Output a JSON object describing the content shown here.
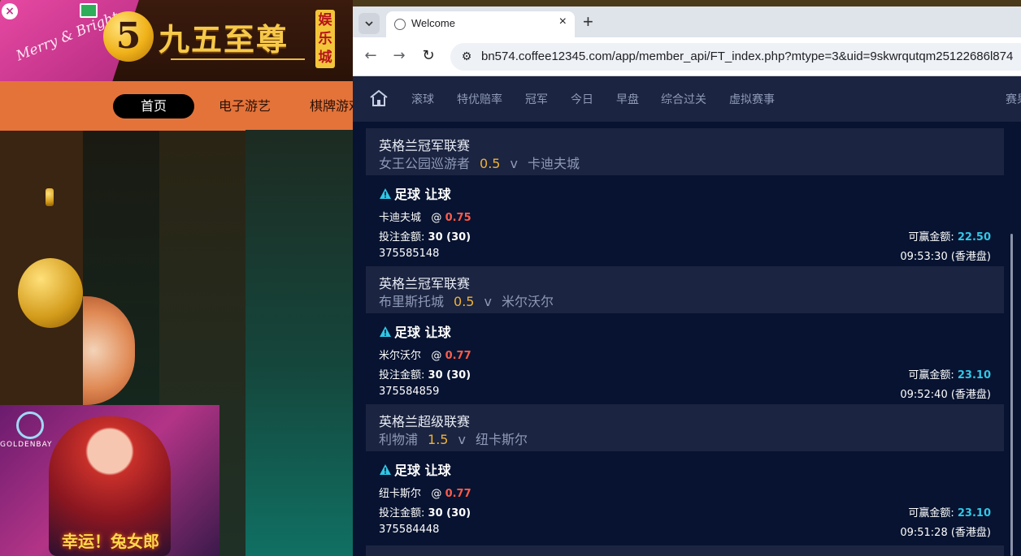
{
  "bg_site": {
    "corner_text": "Merry & Bright",
    "close_glyph": "×",
    "logo_numeral": "5",
    "logo_text": "九五至尊",
    "logo_side": "娱乐城",
    "nav": [
      "首页",
      "电子游艺",
      "棋牌游戏"
    ],
    "promo_brand": "GOLDENBAY",
    "promo_title": "幸运！兔女郎"
  },
  "browser": {
    "tab_dropdown_icon": "chevron-down-icon",
    "tab_title": "Welcome",
    "tab_close": "×",
    "new_tab": "+",
    "back": "←",
    "forward": "→",
    "reload": "↻",
    "site_info": "⚙",
    "url": "bn574.coffee12345.com/app/member_api/FT_index.php?mtype=3&uid=9skwrqutqm25122686l874"
  },
  "page": {
    "nav": [
      "滚球",
      "特优赔率",
      "冠军",
      "今日",
      "早盘",
      "综合过关",
      "虚拟赛事",
      "赛果"
    ],
    "labels": {
      "bet_type": "足球 让球",
      "stake": "投注金额:",
      "win": "可赢金额:",
      "at": "@"
    },
    "bets": [
      {
        "league": "英格兰冠军联赛",
        "home": "女王公园巡游者",
        "handicap": "0.5",
        "vs": "v",
        "away": "卡迪夫城",
        "pick": "卡迪夫城",
        "odds": "0.75",
        "stake": "30 (30)",
        "win": "22.50",
        "ticket": "375585148",
        "time": "09:53:30 (香港盘)"
      },
      {
        "league": "英格兰冠军联赛",
        "home": "布里斯托城",
        "handicap": "0.5",
        "vs": "v",
        "away": "米尔沃尔",
        "pick": "米尔沃尔",
        "odds": "0.77",
        "stake": "30 (30)",
        "win": "23.10",
        "ticket": "375584859",
        "time": "09:52:40 (香港盘)"
      },
      {
        "league": "英格兰超级联赛",
        "home": "利物浦",
        "handicap": "1.5",
        "vs": "v",
        "away": "纽卡斯尔",
        "pick": "纽卡斯尔",
        "odds": "0.77",
        "stake": "30 (30)",
        "win": "23.10",
        "ticket": "375584448",
        "time": "09:51:28 (香港盘)"
      }
    ]
  },
  "colors": {
    "page_bg": "#071330",
    "card_head": "#1b2440",
    "handicap": "#f2b233",
    "odds": "#ff5a4a",
    "win_amount": "#31c7e6",
    "warning": "#31c7e6"
  }
}
